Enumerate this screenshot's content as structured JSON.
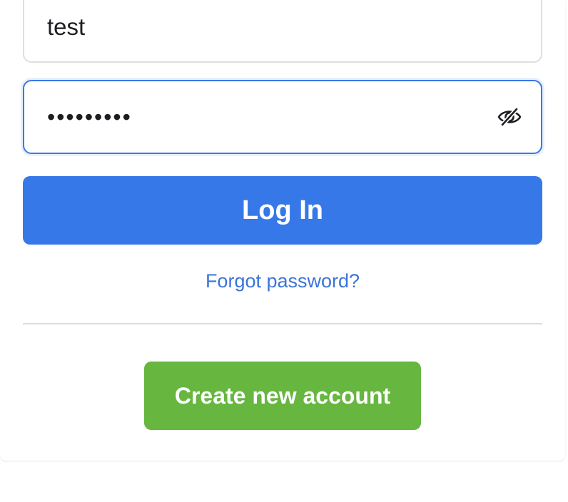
{
  "login_form": {
    "email_value": "test",
    "password_value": "testtest1",
    "password_toggle_icon": "eye-slash-icon",
    "login_button_label": "Log In",
    "forgot_password_label": "Forgot password?",
    "create_account_label": "Create new account"
  },
  "colors": {
    "primary": "#3778e9",
    "link": "#3b74d9",
    "success": "#67b640",
    "focus_border": "#3b77e8"
  }
}
